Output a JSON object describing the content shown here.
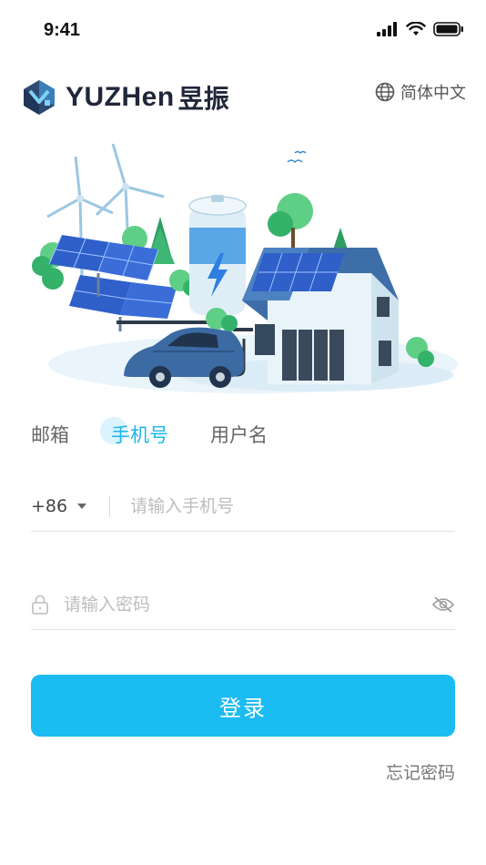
{
  "status": {
    "time": "9:41"
  },
  "brand": {
    "wordmark": "YUZHen",
    "cn": "昱振"
  },
  "language": {
    "label": "简体中文",
    "icon": "globe-icon"
  },
  "tabs": [
    {
      "label": "邮箱",
      "active": false
    },
    {
      "label": "手机号",
      "active": true
    },
    {
      "label": "用户名",
      "active": false
    }
  ],
  "phone": {
    "country_code": "+86",
    "placeholder": "请输入手机号"
  },
  "password": {
    "placeholder": "请输入密码"
  },
  "login": {
    "label": "登录"
  },
  "forgot": {
    "label": "忘记密码"
  },
  "colors": {
    "accent": "#1bbcf1",
    "tab_active": "#1bb7ea",
    "brand_dark": "#20273a"
  }
}
